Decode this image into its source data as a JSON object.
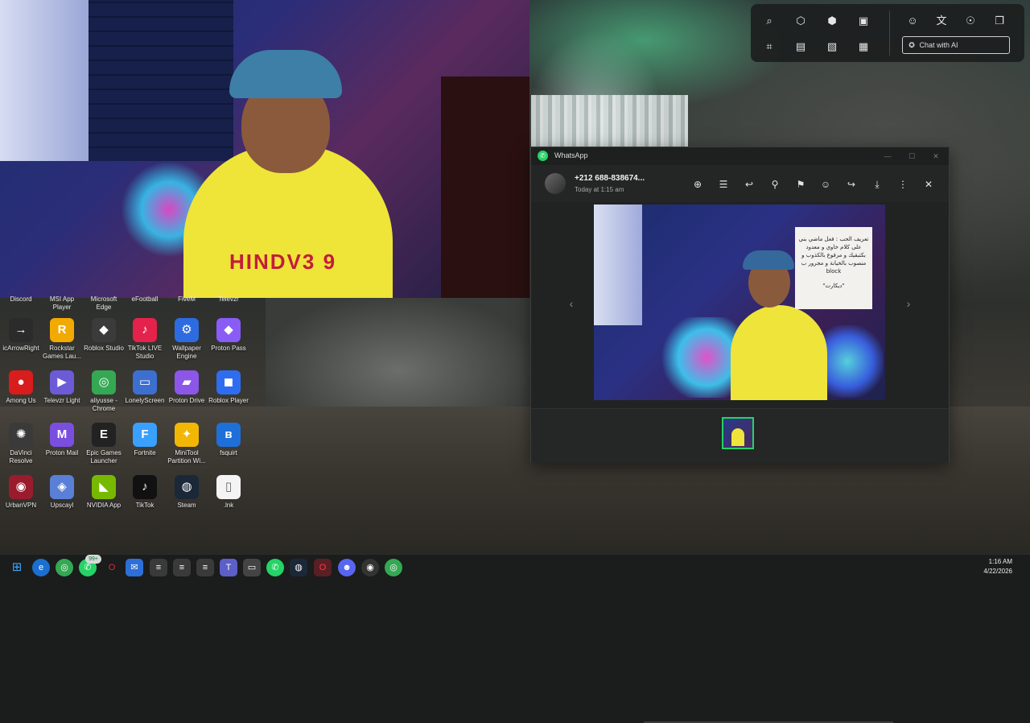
{
  "webcam": {
    "jersey_text": "HINDV3 9"
  },
  "desktop": {
    "partial_row": [
      "Discord",
      "MSI App Player",
      "Microsoft Edge",
      "eFootball",
      "FiveM",
      "Televzr"
    ],
    "icons": [
      {
        "label": "icArrowRight",
        "glyph": "→",
        "color": "#2b2b2b",
        "icon": "arrow-right-icon"
      },
      {
        "label": "Rockstar Games Lau...",
        "glyph": "R",
        "color": "#f2a900",
        "icon": "rockstar-icon"
      },
      {
        "label": "Roblox Studio",
        "glyph": "◆",
        "color": "#3b3b3b",
        "icon": "roblox-studio-icon"
      },
      {
        "label": "TikTok LIVE Studio",
        "glyph": "♪",
        "color": "#e4224c",
        "icon": "tiktok-live-icon"
      },
      {
        "label": "Wallpaper Engine",
        "glyph": "⚙",
        "color": "#2d6be0",
        "icon": "wallpaper-engine-icon"
      },
      {
        "label": "Proton Pass",
        "glyph": "◆",
        "color": "#8a5cf6",
        "icon": "proton-pass-icon"
      },
      {
        "label": "Among Us",
        "glyph": "●",
        "color": "#d91c1c",
        "icon": "among-us-icon"
      },
      {
        "label": "Televzr Light",
        "glyph": "▶",
        "color": "#6b5bd6",
        "icon": "televzr-icon"
      },
      {
        "label": "aliyusse - Chrome",
        "glyph": "◎",
        "color": "#34a853",
        "icon": "chrome-icon"
      },
      {
        "label": "LonelyScreen",
        "glyph": "▭",
        "color": "#3d6fd1",
        "icon": "lonelyscreen-icon"
      },
      {
        "label": "Proton Drive",
        "glyph": "▰",
        "color": "#8c56e8",
        "icon": "proton-drive-icon"
      },
      {
        "label": "Roblox Player",
        "glyph": "◼",
        "color": "#2f6df0",
        "icon": "roblox-player-icon"
      },
      {
        "label": "DaVinci Resolve",
        "glyph": "✺",
        "color": "#3a3a3a",
        "icon": "davinci-icon"
      },
      {
        "label": "Proton Mail",
        "glyph": "M",
        "color": "#7a4fe0",
        "icon": "proton-mail-icon"
      },
      {
        "label": "Epic Games Launcher",
        "glyph": "E",
        "color": "#222222",
        "icon": "epic-games-icon"
      },
      {
        "label": "Fortnite",
        "glyph": "F",
        "color": "#3aa0ff",
        "icon": "fortnite-icon"
      },
      {
        "label": "MiniTool Partition Wi...",
        "glyph": "✦",
        "color": "#f2b705",
        "icon": "minitool-icon"
      },
      {
        "label": "fsquirt",
        "glyph": "ʙ",
        "color": "#1e70d8",
        "icon": "bluetooth-icon"
      },
      {
        "label": "UrbanVPN",
        "glyph": "◉",
        "color": "#9a1c2c",
        "icon": "urbanvpn-icon"
      },
      {
        "label": "Upscayl",
        "glyph": "◈",
        "color": "#5a7fd6",
        "icon": "upscayl-icon"
      },
      {
        "label": "NVIDIA App",
        "glyph": "◣",
        "color": "#76b900",
        "icon": "nvidia-icon"
      },
      {
        "label": "TikTok",
        "glyph": "♪",
        "color": "#111111",
        "icon": "tiktok-icon"
      },
      {
        "label": "Steam",
        "glyph": "◍",
        "color": "#1b2838",
        "icon": "steam-icon"
      },
      {
        "label": ".lnk",
        "glyph": "▯",
        "color": "#f4f4f4",
        "icon": "file-icon"
      }
    ]
  },
  "snip_toolbar": {
    "chat_ai_label": "Chat with AI"
  },
  "whatsapp": {
    "app_title": "WhatsApp",
    "contact": "+212 688-838674...",
    "timestamp": "Today at 1:15 am",
    "note_text": "تعريف الحب : فعل ماضي بني على كلام خاوي و معدود بكتبقيك و مرفوع بالكذوب و منصوب بالخيانة و مجرور ب block",
    "note_signature": "\"ديكارت\""
  },
  "taskbar": {
    "whatsapp_badge": "99+",
    "time": "1:16 AM",
    "date": "4/22/2026"
  }
}
